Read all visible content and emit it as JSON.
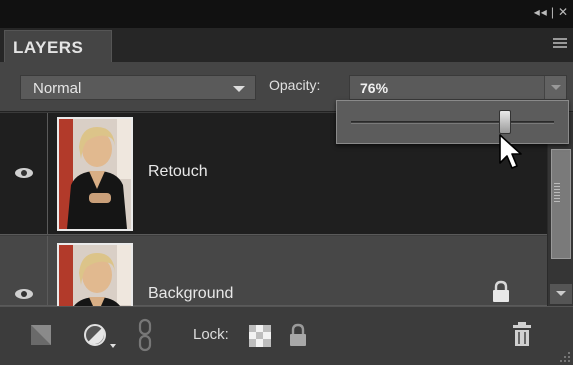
{
  "window": {
    "controls": [
      "◂◂",
      "|",
      "✕"
    ]
  },
  "panel": {
    "tab_label": "LAYERS",
    "menu_icon": "panel-menu-icon"
  },
  "options": {
    "blend_mode": "Normal",
    "opacity_label": "Opacity:",
    "opacity_value": "76%",
    "opacity_slider_fraction": 0.76
  },
  "layers": [
    {
      "name": "Retouch",
      "selected": true,
      "visible": true,
      "locked": false
    },
    {
      "name": "Background",
      "selected": false,
      "visible": true,
      "locked": true
    }
  ],
  "bottom_bar": {
    "lock_label": "Lock:",
    "icons": [
      "new-layer-icon",
      "adjustment-layer-icon",
      "link-icon",
      "lock-transparent-icon",
      "lock-all-icon",
      "trash-icon"
    ]
  },
  "colors": {
    "panel_bg": "#454545",
    "selected_row": "#1f1f1f",
    "titlebar": "#111111"
  }
}
